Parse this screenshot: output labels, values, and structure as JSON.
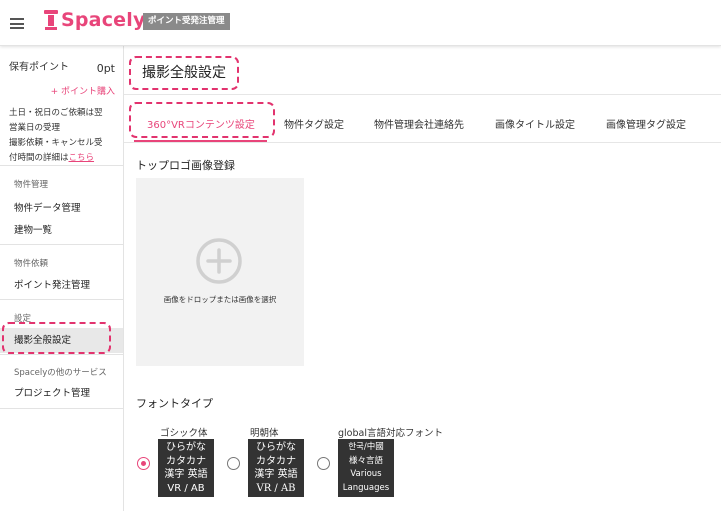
{
  "header": {
    "brand": "Spacely",
    "badge": "ポイント受発注管理"
  },
  "sidebar": {
    "points_label": "保有ポイント",
    "points_value": "0pt",
    "buy_points": "+ ポイント購入",
    "notice_line1": "土日・祝日のご依頼は翌",
    "notice_line2": "営業日の受理",
    "notice_line3": "撮影依頼・キャンセル受",
    "notice_line4": "付時間の詳細は",
    "notice_link": "こちら",
    "sections": [
      {
        "title": "物件管理",
        "items": [
          "物件データ管理",
          "建物一覧"
        ]
      },
      {
        "title": "物件依頼",
        "items": [
          "ポイント発注管理"
        ]
      },
      {
        "title": "設定",
        "items": [
          "撮影全般設定"
        ]
      },
      {
        "title": "Spacelyの他のサービス",
        "items": [
          "プロジェクト管理"
        ]
      }
    ]
  },
  "main": {
    "title": "撮影全般設定",
    "tabs": [
      "360°VRコンテンツ設定",
      "物件タグ設定",
      "物件管理会社連絡先",
      "画像タイトル設定",
      "画像管理タグ設定"
    ],
    "logo_section": "トップロゴ画像登録",
    "drop_text": "画像をドロップまたは画像を選択",
    "font_section": "フォントタイプ",
    "font_options": [
      {
        "label": "ゴシック体",
        "sample": [
          "ひらがな",
          "カタカナ",
          "漢字 英語",
          "VR / AB"
        ],
        "selected": true
      },
      {
        "label": "明朝体",
        "sample": [
          "ひらがな",
          "カタカナ",
          "漢字 英語",
          "VR / AB"
        ],
        "selected": false
      },
      {
        "label": "global言語対応フォント",
        "sample": [
          "한국/中國",
          "様々言語",
          "Various",
          "Languages"
        ],
        "selected": false
      }
    ]
  },
  "colors": {
    "accent": "#e8457a",
    "highlight": "#e2336e",
    "badge_bg": "#8a8a8a",
    "active_item_bg": "#e8e8e8"
  }
}
